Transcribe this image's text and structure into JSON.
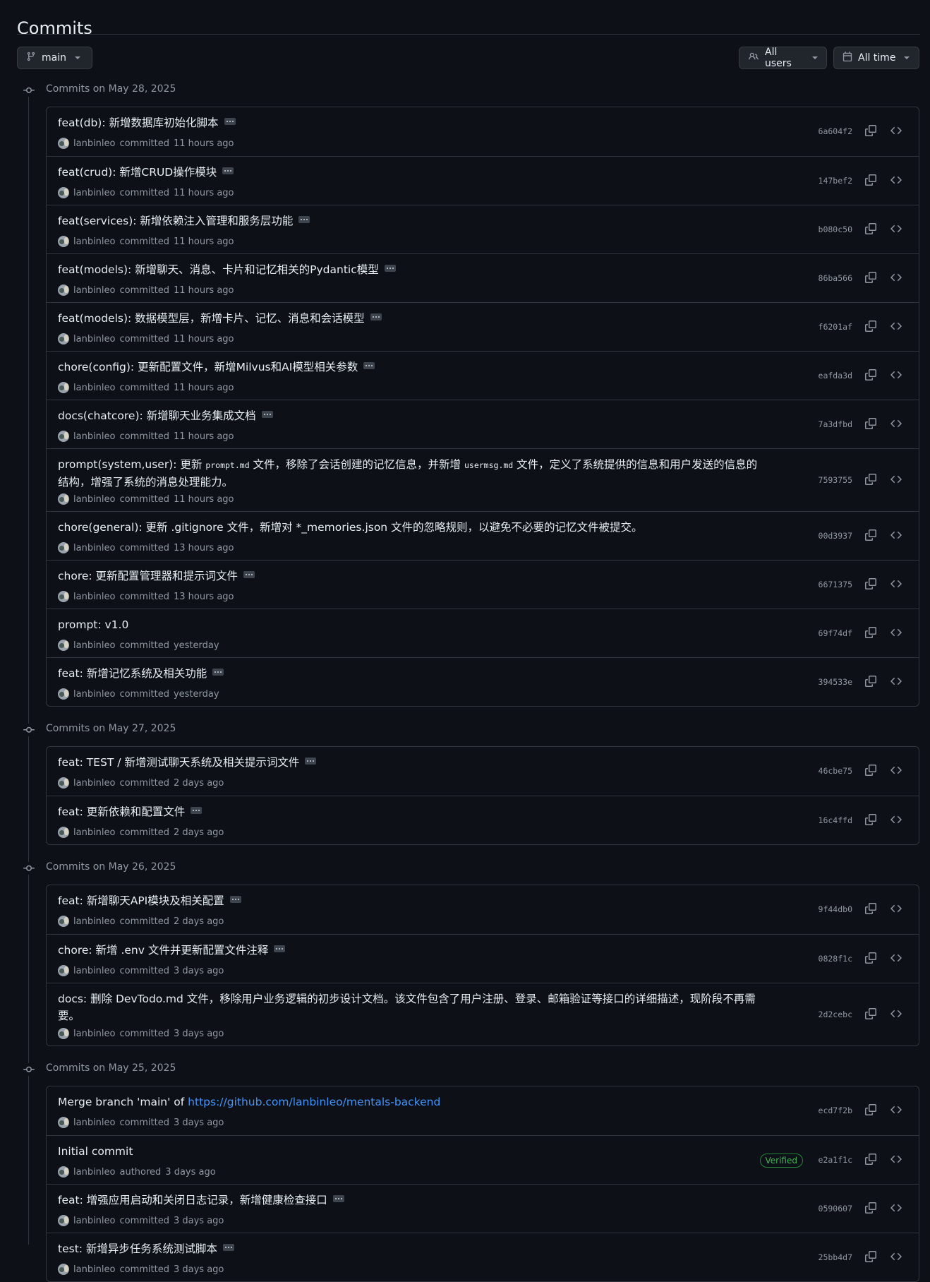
{
  "header": {
    "title": "Commits"
  },
  "filters": {
    "branch": "main",
    "users": "All users",
    "time": "All time"
  },
  "groups": [
    {
      "label": "Commits on May 28, 2025",
      "commits": [
        {
          "message": "feat(db): 新增数据库初始化脚本",
          "author": "lanbinleo",
          "action": "committed",
          "time": "11 hours ago",
          "sha": "6a604f2",
          "more": true
        },
        {
          "message": "feat(crud): 新增CRUD操作模块",
          "author": "lanbinleo",
          "action": "committed",
          "time": "11 hours ago",
          "sha": "147bef2",
          "more": true
        },
        {
          "message": "feat(services): 新增依赖注入管理和服务层功能",
          "author": "lanbinleo",
          "action": "committed",
          "time": "11 hours ago",
          "sha": "b080c50",
          "more": true
        },
        {
          "message": "feat(models): 新增聊天、消息、卡片和记忆相关的Pydantic模型",
          "author": "lanbinleo",
          "action": "committed",
          "time": "11 hours ago",
          "sha": "86ba566",
          "more": true
        },
        {
          "message": "feat(models): 数据模型层，新增卡片、记忆、消息和会话模型",
          "author": "lanbinleo",
          "action": "committed",
          "time": "11 hours ago",
          "sha": "f6201af",
          "more": true
        },
        {
          "message": "chore(config): 更新配置文件，新增Milvus和AI模型相关参数",
          "author": "lanbinleo",
          "action": "committed",
          "time": "11 hours ago",
          "sha": "eafda3d",
          "more": true
        },
        {
          "message": "docs(chatcore): 新增聊天业务集成文档",
          "author": "lanbinleo",
          "action": "committed",
          "time": "11 hours ago",
          "sha": "7a3dfbd",
          "more": true
        },
        {
          "message_parts": [
            "prompt(system,user): 更新 ",
            "prompt.md",
            " 文件，移除了会话创建的记忆信息，并新增 ",
            "usermsg.md",
            " 文件，定义了系统提供的信息和用户发送的信息的结构，增强了系统的消息处理能力。"
          ],
          "author": "lanbinleo",
          "action": "committed",
          "time": "11 hours ago",
          "sha": "7593755",
          "more": false,
          "multiline": true
        },
        {
          "message": "chore(general): 更新 .gitignore 文件，新增对 *_memories.json 文件的忽略规则，以避免不必要的记忆文件被提交。",
          "author": "lanbinleo",
          "action": "committed",
          "time": "13 hours ago",
          "sha": "00d3937",
          "more": false
        },
        {
          "message": "chore: 更新配置管理器和提示词文件",
          "author": "lanbinleo",
          "action": "committed",
          "time": "13 hours ago",
          "sha": "6671375",
          "more": true
        },
        {
          "message": "prompt: v1.0",
          "author": "lanbinleo",
          "action": "committed",
          "time": "yesterday",
          "sha": "69f74df",
          "more": false
        },
        {
          "message": "feat: 新增记忆系统及相关功能",
          "author": "lanbinleo",
          "action": "committed",
          "time": "yesterday",
          "sha": "394533e",
          "more": true
        }
      ]
    },
    {
      "label": "Commits on May 27, 2025",
      "commits": [
        {
          "message": "feat: TEST / 新增测试聊天系统及相关提示词文件",
          "author": "lanbinleo",
          "action": "committed",
          "time": "2 days ago",
          "sha": "46cbe75",
          "more": true
        },
        {
          "message": "feat: 更新依赖和配置文件",
          "author": "lanbinleo",
          "action": "committed",
          "time": "2 days ago",
          "sha": "16c4ffd",
          "more": true
        }
      ]
    },
    {
      "label": "Commits on May 26, 2025",
      "commits": [
        {
          "message": "feat: 新增聊天API模块及相关配置",
          "author": "lanbinleo",
          "action": "committed",
          "time": "2 days ago",
          "sha": "9f44db0",
          "more": true
        },
        {
          "message": "chore: 新增 .env 文件并更新配置文件注释",
          "author": "lanbinleo",
          "action": "committed",
          "time": "3 days ago",
          "sha": "0828f1c",
          "more": true
        },
        {
          "message": "docs: 删除 DevTodo.md 文件，移除用户业务逻辑的初步设计文档。该文件包含了用户注册、登录、邮箱验证等接口的详细描述，现阶段不再需要。",
          "author": "lanbinleo",
          "action": "committed",
          "time": "3 days ago",
          "sha": "2d2cebc",
          "more": false,
          "multiline": true
        }
      ]
    },
    {
      "label": "Commits on May 25, 2025",
      "commits": [
        {
          "message": "Merge branch 'main' of ",
          "link": "https://github.com/lanbinleo/mentals-backend",
          "author": "lanbinleo",
          "action": "committed",
          "time": "3 days ago",
          "sha": "ecd7f2b",
          "more": false
        },
        {
          "message": "Initial commit",
          "author": "lanbinleo",
          "action": "authored",
          "time": "3 days ago",
          "sha": "e2a1f1c",
          "more": false,
          "verified": "Verified"
        },
        {
          "message": "feat: 增强应用启动和关闭日志记录，新增健康检查接口",
          "author": "lanbinleo",
          "action": "committed",
          "time": "3 days ago",
          "sha": "0590607",
          "more": true
        },
        {
          "message": "test: 新增异步任务系统测试脚本",
          "author": "lanbinleo",
          "action": "committed",
          "time": "3 days ago",
          "sha": "25bb4d7",
          "more": true
        }
      ]
    }
  ],
  "colors": {
    "background": "#0d1117",
    "border": "#30363d",
    "muted": "#9198a1",
    "link": "#4493f8",
    "verified": "#3fb950"
  }
}
